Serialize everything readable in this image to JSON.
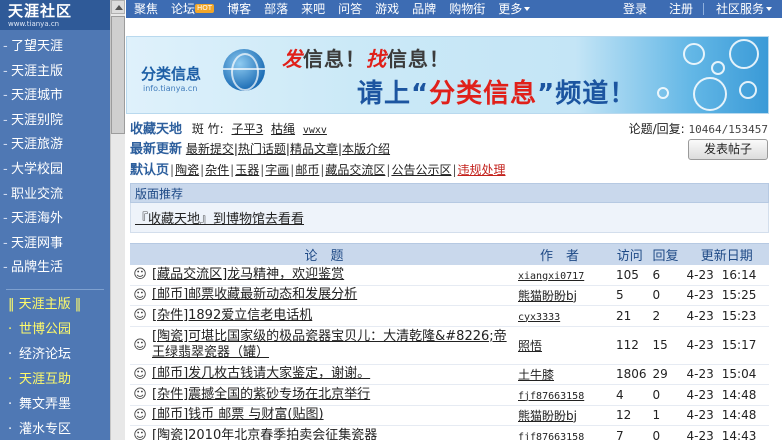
{
  "sidebar": {
    "logo": "天涯社区",
    "logo_sub": "www.tianya.cn",
    "items": [
      "了望天涯",
      "天涯主版",
      "天涯城市",
      "天涯别院",
      "天涯旅游",
      "大学校园",
      "职业交流",
      "天涯海外",
      "天涯网事",
      "品牌生活"
    ],
    "sub_header": "‖ 天涯主版 ‖",
    "sub_items": [
      {
        "label": "世博公园",
        "highlight": true
      },
      {
        "label": "经济论坛",
        "highlight": false
      },
      {
        "label": "天涯互助",
        "highlight": true
      },
      {
        "label": "舞文弄墨",
        "highlight": false
      },
      {
        "label": "灌水专区",
        "highlight": false
      }
    ]
  },
  "topnav": {
    "items": [
      "聚焦",
      "论坛",
      "博客",
      "部落",
      "来吧",
      "问答",
      "游戏",
      "品牌",
      "购物街",
      "更多"
    ],
    "hot_badge": "HOT",
    "right": [
      "登录",
      "注册",
      "社区服务"
    ]
  },
  "banner": {
    "brand": "分类信息",
    "url": "info.tianya.cn",
    "line1_a": "发",
    "line1_b": "信息！",
    "line1_c": "找",
    "line1_d": "信息！",
    "line2_a": "请上“",
    "line2_b": "分类信息",
    "line2_c": "”频道！"
  },
  "forum": {
    "name": "收藏天地",
    "mod_label": "斑 竹:",
    "mods": [
      "子平3",
      "枯绳",
      "vwxv"
    ],
    "stats_label": "论题/回复:",
    "stats_value": "10464/153457",
    "latest_label": "最新更新",
    "latest_links": [
      "最新提交",
      "热门话题",
      "精品文章",
      "本版介绍"
    ],
    "post_button": "发表帖子",
    "default_label": "默认页",
    "categories": [
      "陶瓷",
      "杂件",
      "玉器",
      "字画",
      "邮币",
      "藏品交流区",
      "公告公示区"
    ],
    "active_category": "违规处理"
  },
  "recommend": {
    "header": "版面推荐",
    "link": "『收藏天地』到博物馆去看看"
  },
  "table": {
    "headers": {
      "topic": "论　题",
      "author": "作　者",
      "visits": "访问",
      "replies": "回复",
      "date": "更新日期"
    },
    "rows": [
      {
        "topic": "[藏品交流区]龙马精神，欢迎鉴赏",
        "author": "xiangxi0717",
        "mono": true,
        "visits": "105",
        "replies": "6",
        "date": "4-23",
        "time": "16:14"
      },
      {
        "topic": "[邮币]邮票收藏最新动态和发展分析",
        "author": "熊猫盼盼bj",
        "mono": false,
        "visits": "5",
        "replies": "0",
        "date": "4-23",
        "time": "15:25"
      },
      {
        "topic": "[杂件]1892爱立信老电话机",
        "author": "cyx3333",
        "mono": true,
        "visits": "21",
        "replies": "2",
        "date": "4-23",
        "time": "15:23"
      },
      {
        "topic": "[陶瓷]可堪比国家级的极品瓷器宝贝儿：大清乾隆&#8226;帝王绿翡翠瓷器（罐）",
        "author": "照悟",
        "mono": false,
        "visits": "112",
        "replies": "15",
        "date": "4-23",
        "time": "15:17"
      },
      {
        "topic": "[邮币]发几枚古钱请大家鉴定，谢谢。",
        "author": "土牛膝",
        "mono": false,
        "visits": "1806",
        "replies": "29",
        "date": "4-23",
        "time": "15:04"
      },
      {
        "topic": "[杂件]震撼全国的紫砂专场在北京举行",
        "author": "fjf87663158",
        "mono": true,
        "visits": "4",
        "replies": "0",
        "date": "4-23",
        "time": "14:48"
      },
      {
        "topic": "[邮币]钱币 邮票 与财富(贴图)",
        "author": "熊猫盼盼bj",
        "mono": false,
        "visits": "12",
        "replies": "1",
        "date": "4-23",
        "time": "14:48"
      },
      {
        "topic": "[陶瓷]2010年北京春季拍卖会征集瓷器",
        "author": "fjf87663158",
        "mono": true,
        "visits": "7",
        "replies": "0",
        "date": "4-23",
        "time": "14:43"
      }
    ]
  }
}
